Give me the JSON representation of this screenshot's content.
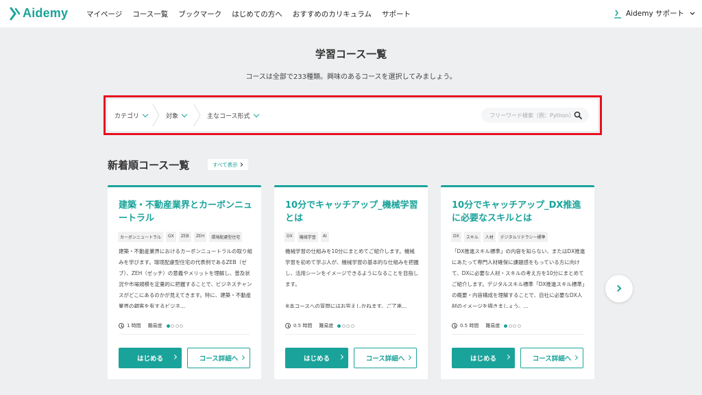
{
  "header": {
    "logo_text": "Aidemy",
    "nav": [
      "マイページ",
      "コース一覧",
      "ブックマーク",
      "はじめての方へ",
      "おすすめのカリキュラム",
      "サポート"
    ],
    "support_label": "Aidemy サポート"
  },
  "page": {
    "title": "学習コース一覧",
    "subtitle": "コースは全部で233種類。興味のあるコースを選択してみましょう。"
  },
  "filters": {
    "category": "カテゴリ",
    "target": "対象",
    "format": "主なコース形式",
    "search_placeholder": "フリーワード検索（例：Python）"
  },
  "section": {
    "title": "新着順コース一覧",
    "view_all": "すべて表示"
  },
  "cards": [
    {
      "title": "建築・不動産業界とカーボンニュートラル",
      "tags": [
        "カーボンニュートラル",
        "GX",
        "ZEB",
        "ZEH",
        "環境配慮型住宅"
      ],
      "description": "建築・不動産業界におけるカーボンニュートラルの取り組みを学びます。環境配慮型住宅の代表例であるZEB（ゼブ）、ZEH（ゼッチ）の意義やメリットを理解し、普及状況や市場規模を定量的に把握することで、ビジネスチャンスがどこにあるのかが見えてきます。特に、建築・不動産業界の顧客を有するビジネ...",
      "duration": "1 時間",
      "difficulty_label": "難易度",
      "difficulty": 1,
      "start_label": "はじめる",
      "detail_label": "コース詳細へ"
    },
    {
      "title": "10分でキャッチアップ_機械学習とは",
      "tags": [
        "DX",
        "機械学習",
        "AI"
      ],
      "description": "機械学習の仕組みを10分にまとめてご紹介します。機械学習を初めて学ぶ人が、機械学習の基本的な仕組みを把握し、活用シーンをイメージできるようになることを目指します。\n\n※本コースへの質問にはお答えしかねます。ご了承...",
      "duration": "0.5 時間",
      "difficulty_label": "難易度",
      "difficulty": 1,
      "start_label": "はじめる",
      "detail_label": "コース詳細へ"
    },
    {
      "title": "10分でキャッチアップ_DX推進に必要なスキルとは",
      "tags": [
        "DX",
        "スキル",
        "人材",
        "デジタルリテラシー標準"
      ],
      "description": "「DX推進スキル標準」の内容を知らない、またはDX推進にあたって専門人材確保に課題感をもっている方に向けて、DXに必要な人材・スキルの考え方を10分にまとめてご紹介します。デジタルスキル標準「DX推進スキル標準」の概要・内容構成を理解することで、自社に必要なDX人材のイメージを描きましょう。...",
      "duration": "0.5 時間",
      "difficulty_label": "難易度",
      "difficulty": 1,
      "start_label": "はじめる",
      "detail_label": "コース詳細へ"
    }
  ],
  "colors": {
    "accent": "#1aa39a",
    "highlight_box": "#e60f1e",
    "background": "#eeeff1"
  }
}
